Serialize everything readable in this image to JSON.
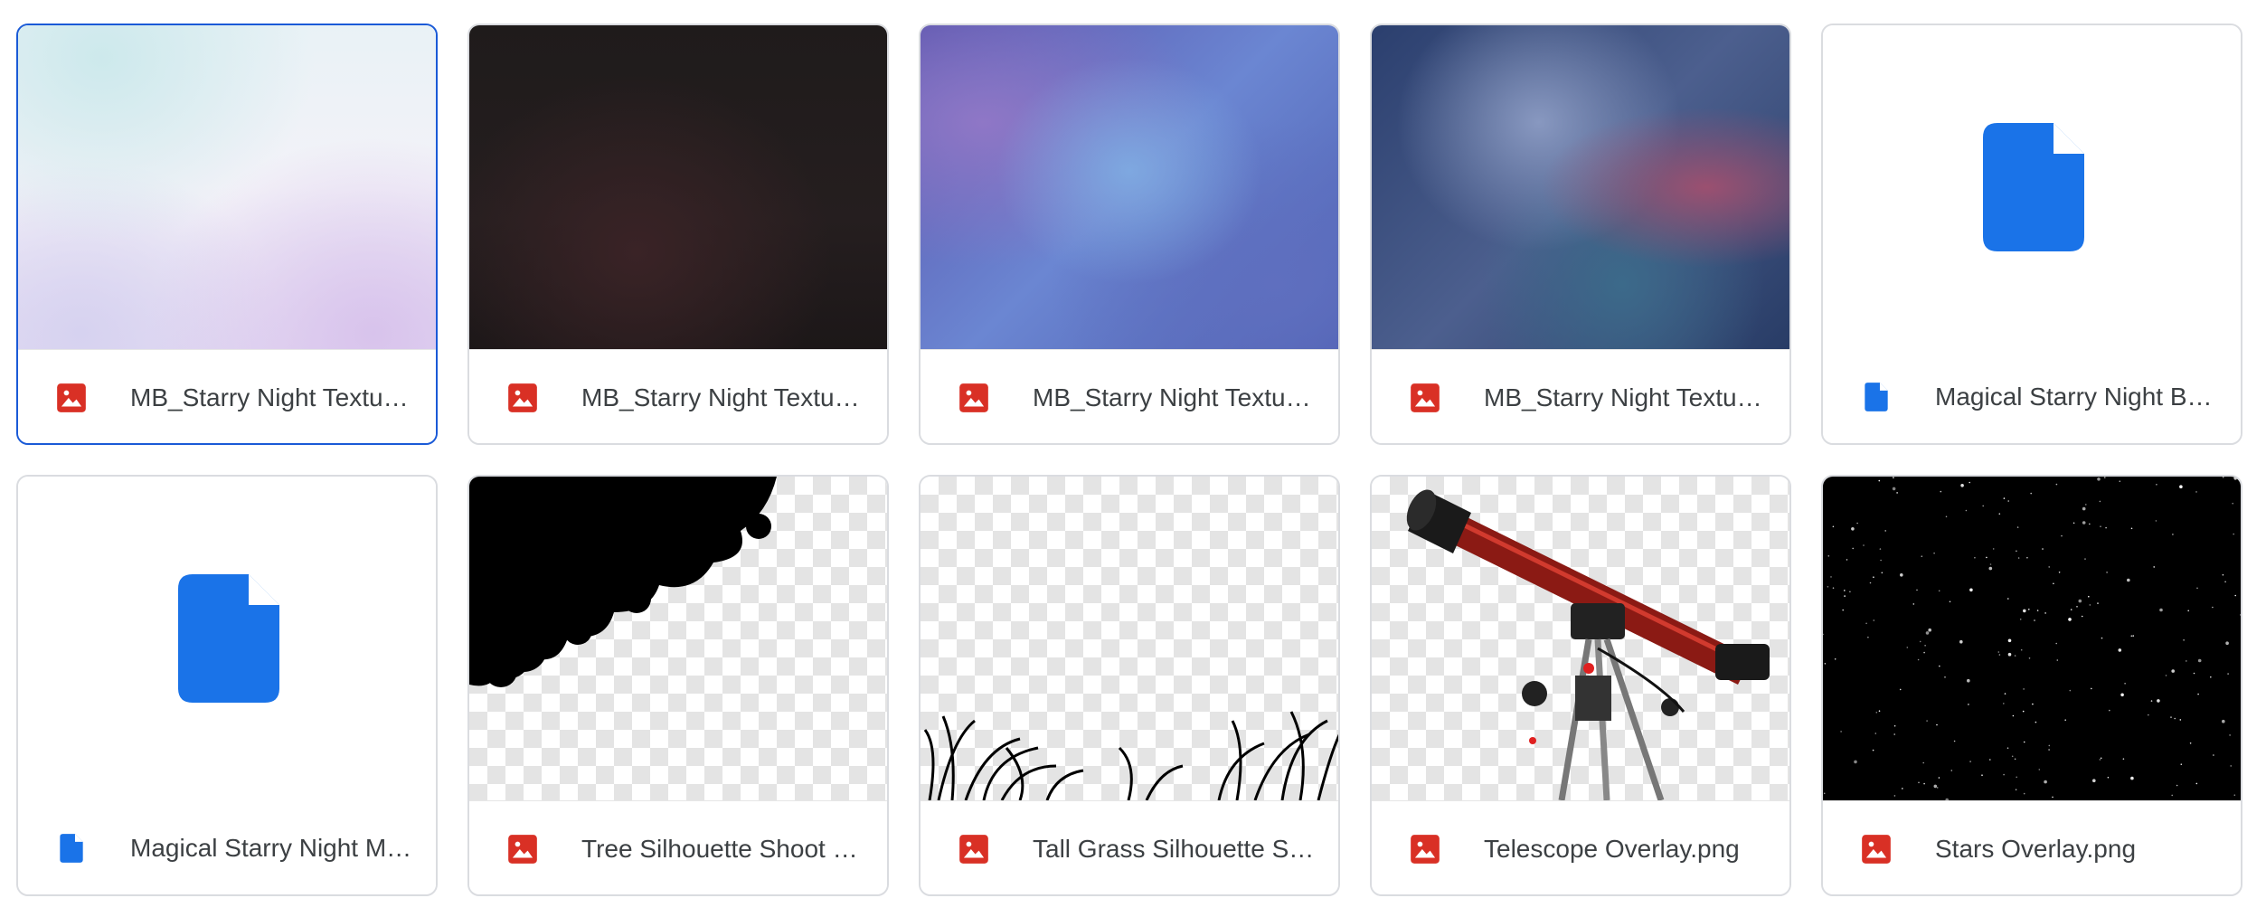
{
  "files": [
    {
      "name": "MB_Starry Night Textu…",
      "type": "image",
      "icon": "image-file-icon",
      "selected": true
    },
    {
      "name": "MB_Starry Night Textu…",
      "type": "image",
      "icon": "image-file-icon"
    },
    {
      "name": "MB_Starry Night Textu…",
      "type": "image",
      "icon": "image-file-icon"
    },
    {
      "name": "MB_Starry Night Textu…",
      "type": "image",
      "icon": "image-file-icon"
    },
    {
      "name": "Magical Starry Night B…",
      "type": "document",
      "icon": "document-file-icon"
    },
    {
      "name": "Magical Starry Night M…",
      "type": "document",
      "icon": "document-file-icon"
    },
    {
      "name": "Tree Silhouette Shoot …",
      "type": "image",
      "icon": "image-file-icon"
    },
    {
      "name": "Tall Grass Silhouette S…",
      "type": "image",
      "icon": "image-file-icon"
    },
    {
      "name": "Telescope Overlay.png",
      "type": "image",
      "icon": "image-file-icon"
    },
    {
      "name": "Stars Overlay.png",
      "type": "image",
      "icon": "image-file-icon"
    }
  ],
  "colors": {
    "image_icon": "#d93025",
    "document_icon": "#1a73e8",
    "selected_border": "#1a5ad7",
    "card_border": "#dadce0",
    "filename_text": "#3c4043"
  }
}
